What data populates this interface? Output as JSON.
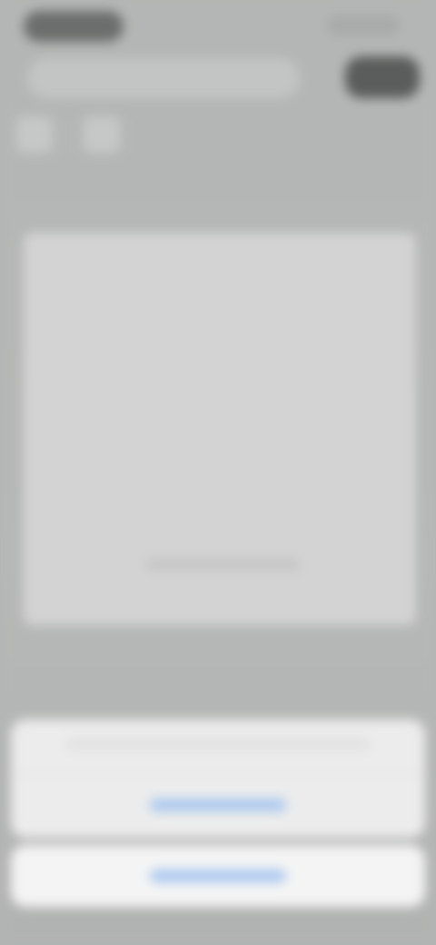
{
  "icons": {
    "status": "status-pill-icon",
    "tool_one": "tool-icon",
    "tool_two": "tool-icon"
  },
  "colors": {
    "accent": "#4b8fe0",
    "sheet_background": "#ececec",
    "backdrop": "#b4b6b5"
  },
  "main_card": {
    "caption": ""
  },
  "action_sheet": {
    "title": "",
    "action_label": "",
    "cancel_label": ""
  }
}
